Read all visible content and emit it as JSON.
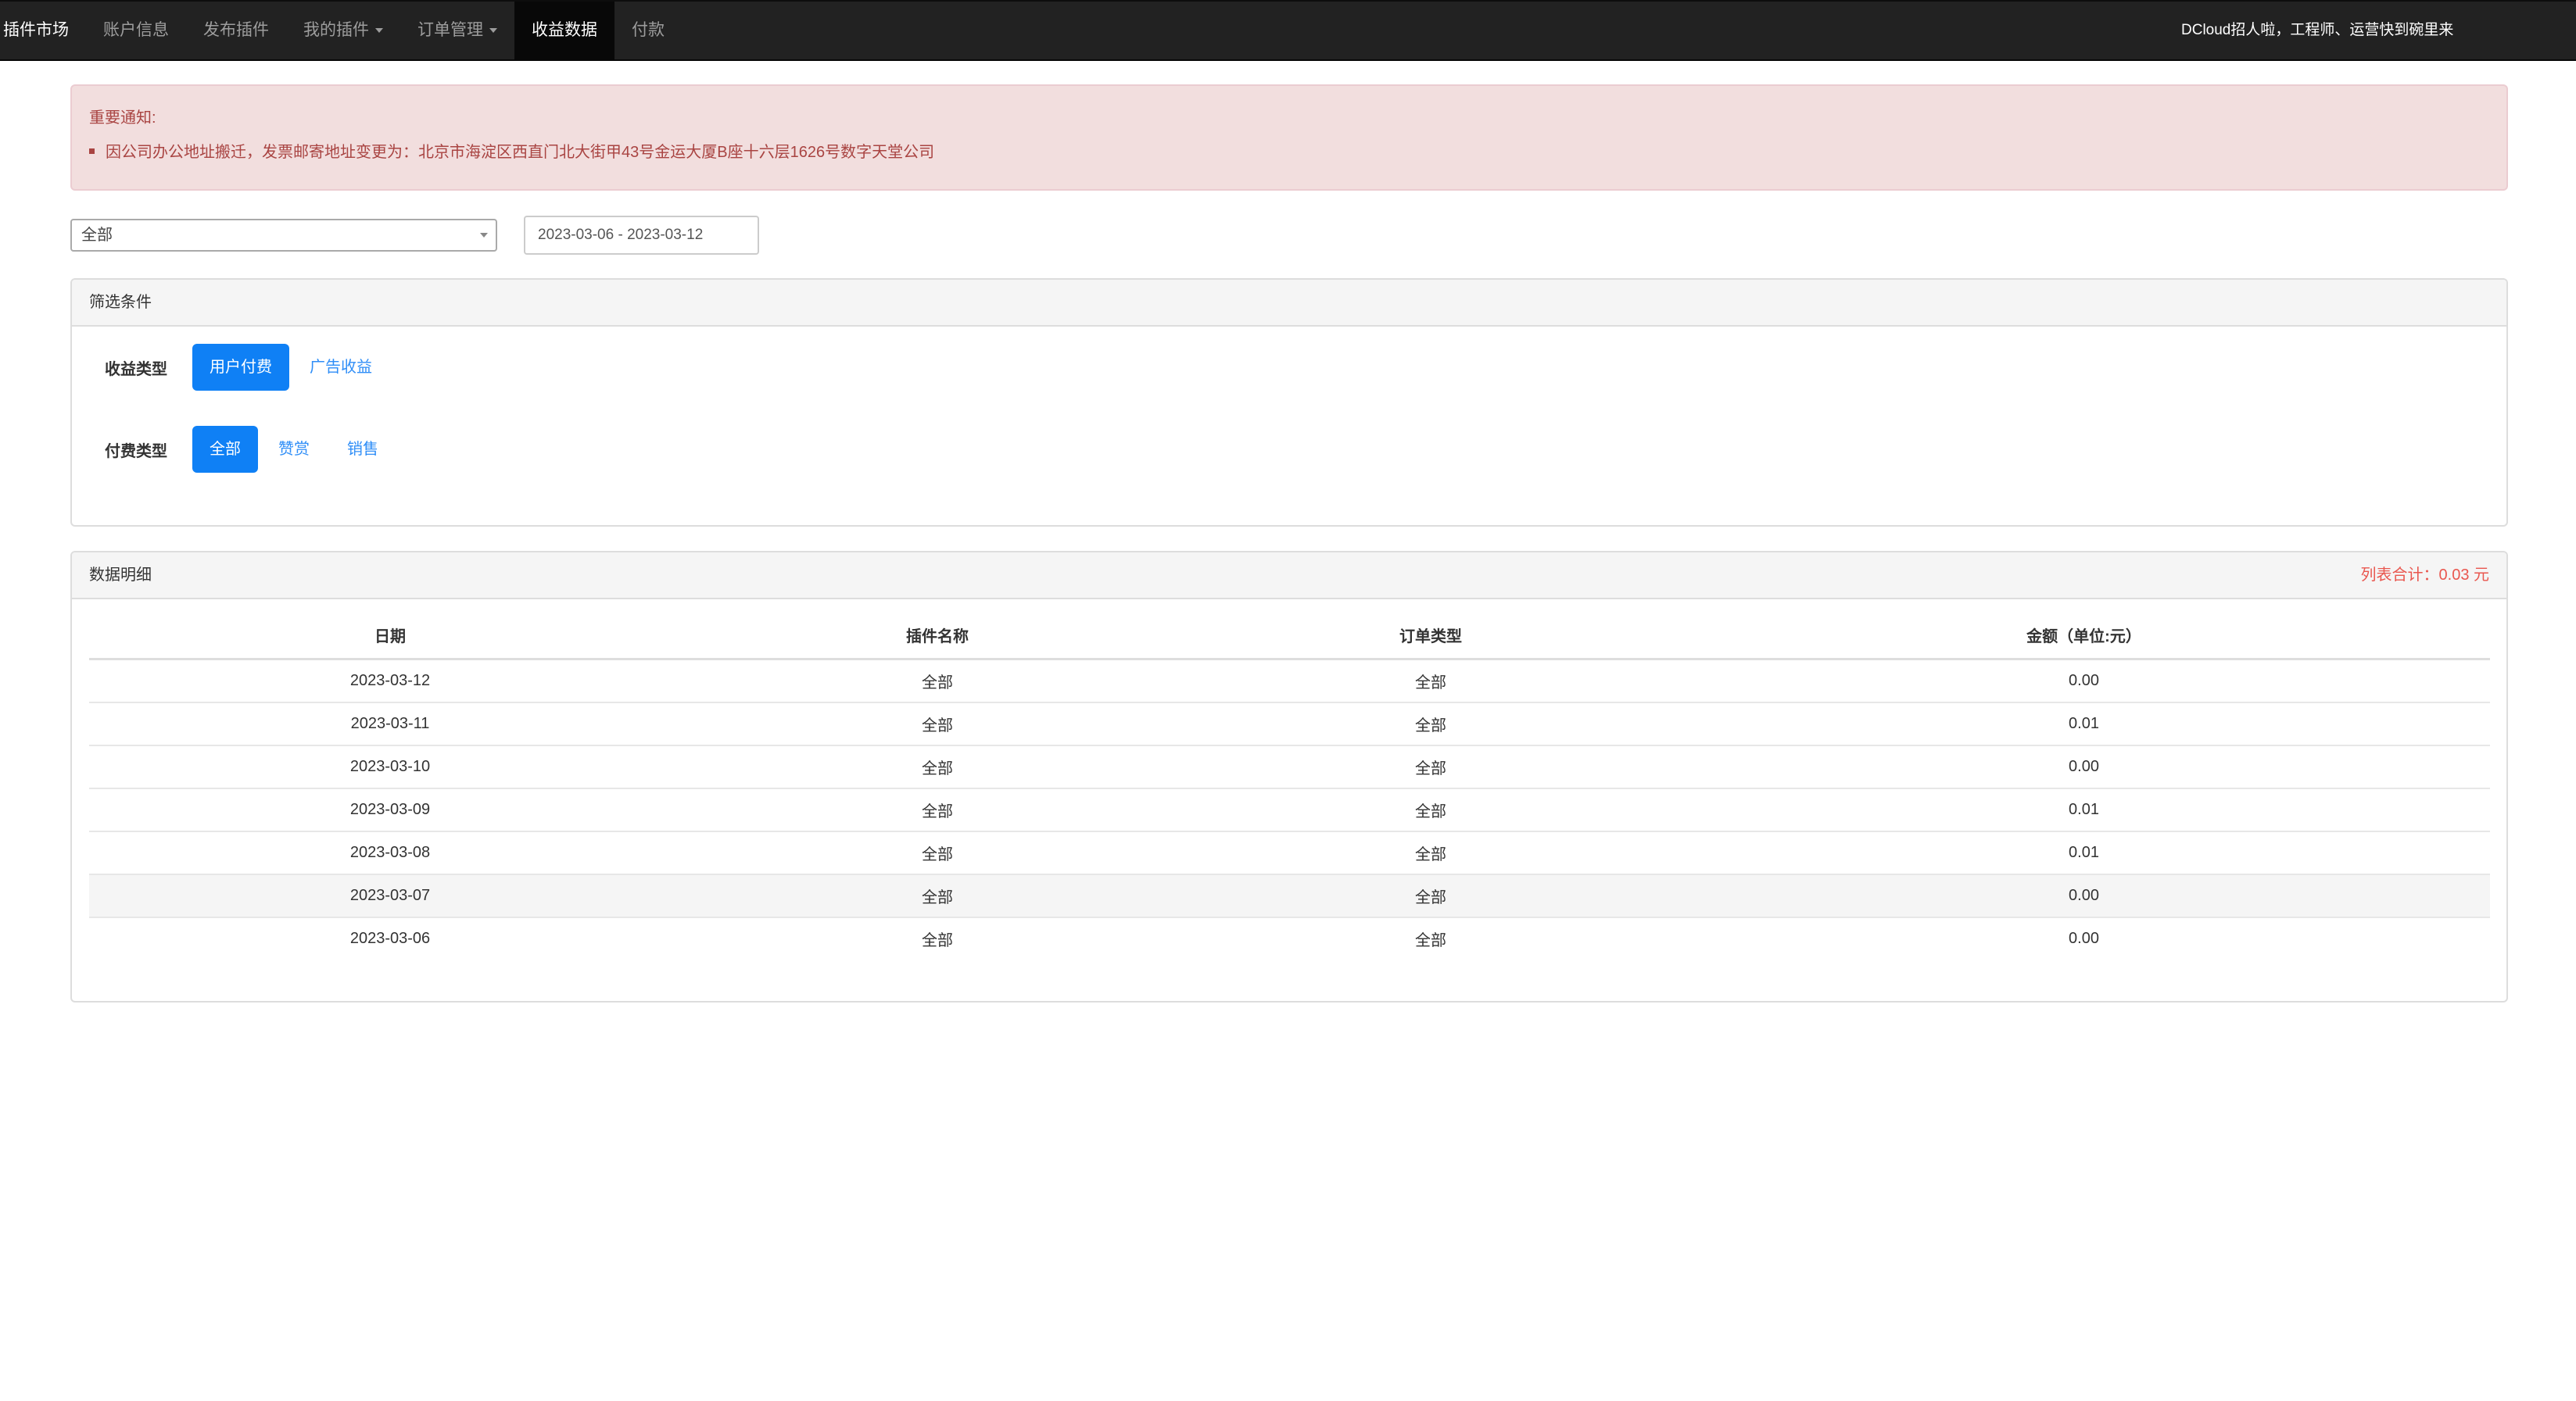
{
  "navbar": {
    "brand": "插件市场",
    "links": [
      "账户信息",
      "发布插件",
      "我的插件",
      "订单管理",
      "收益数据",
      "付款"
    ],
    "active_index": 4,
    "dropdown_indices": [
      2,
      3
    ],
    "right_text": "DCloud招人啦，工程师、运营快到碗里来"
  },
  "alert": {
    "title": "重要通知:",
    "item": "因公司办公地址搬迁，发票邮寄地址变更为：北京市海淀区西直门北大街甲43号金运大厦B座十六层1626号数字天堂公司"
  },
  "filters": {
    "select_value": "全部",
    "date_range": "2023-03-06 - 2023-03-12"
  },
  "filter_panel": {
    "title": "筛选条件",
    "income_type": {
      "label": "收益类型",
      "options": [
        "用户付费",
        "广告收益"
      ],
      "active": "用户付费"
    },
    "pay_type": {
      "label": "付费类型",
      "options": [
        "全部",
        "赞赏",
        "销售"
      ],
      "active": "全部"
    }
  },
  "data_panel": {
    "title": "数据明细",
    "total": "列表合计：0.03 元",
    "columns": [
      "日期",
      "插件名称",
      "订单类型",
      "金额（单位:元）"
    ],
    "rows": [
      [
        "2023-03-12",
        "全部",
        "全部",
        "0.00"
      ],
      [
        "2023-03-11",
        "全部",
        "全部",
        "0.01"
      ],
      [
        "2023-03-10",
        "全部",
        "全部",
        "0.00"
      ],
      [
        "2023-03-09",
        "全部",
        "全部",
        "0.01"
      ],
      [
        "2023-03-08",
        "全部",
        "全部",
        "0.01"
      ],
      [
        "2023-03-07",
        "全部",
        "全部",
        "0.00"
      ],
      [
        "2023-03-06",
        "全部",
        "全部",
        "0.00"
      ]
    ],
    "hover_row_index": 5
  },
  "colors": {
    "navbar_bg": "#222222",
    "active_nav_bg": "#080808",
    "alert_bg": "#f2dede",
    "alert_text": "#a94442",
    "primary": "#0f80f5",
    "total_text": "#e9574f"
  }
}
